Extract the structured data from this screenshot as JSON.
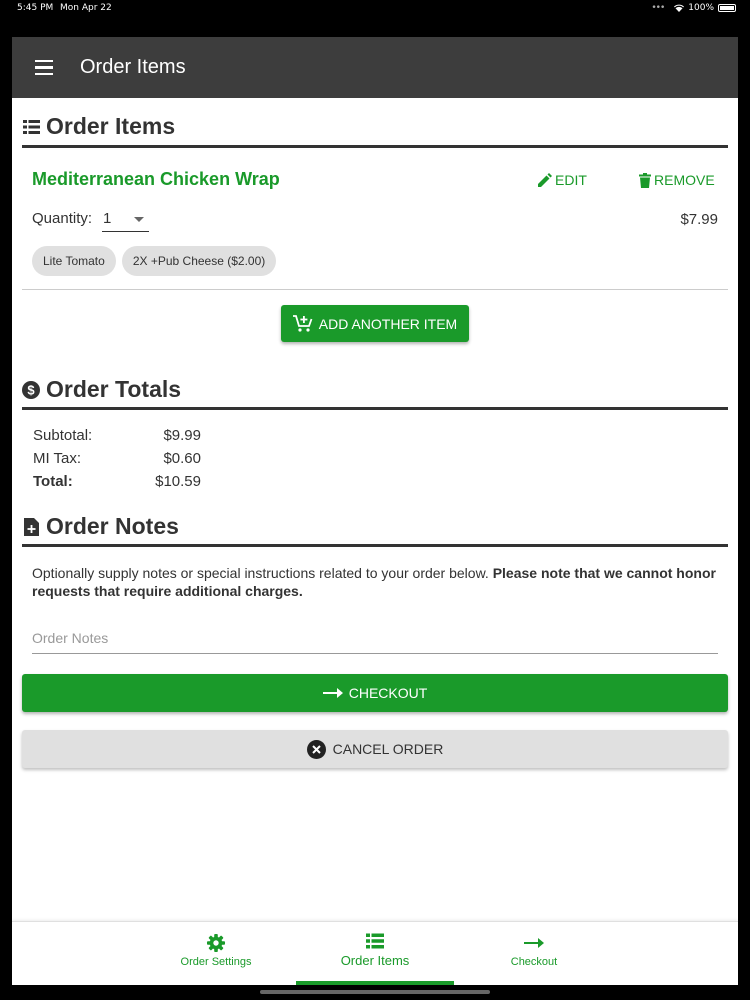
{
  "status_bar": {
    "time": "5:45 PM",
    "date": "Mon Apr 22",
    "battery": "100%"
  },
  "appbar": {
    "title": "Order Items"
  },
  "items_section": {
    "title": "Order Items"
  },
  "item": {
    "name": "Mediterranean Chicken Wrap",
    "edit_label": "EDIT",
    "remove_label": "REMOVE",
    "quantity_label": "Quantity:",
    "quantity_value": "1",
    "price": "$7.99",
    "modifiers": [
      "Lite Tomato",
      "2X +Pub Cheese ($2.00)"
    ]
  },
  "add_button": {
    "label": "ADD ANOTHER ITEM"
  },
  "totals_section": {
    "title": "Order Totals",
    "rows": [
      {
        "label": "Subtotal:",
        "value": "$9.99"
      },
      {
        "label": "MI Tax:",
        "value": "$0.60"
      },
      {
        "label": "Total:",
        "value": "$10.59"
      }
    ]
  },
  "notes_section": {
    "title": "Order Notes",
    "description": "Optionally supply notes or special instructions related to your order below.",
    "description_bold": "Please note that we cannot honor requests that require additional charges.",
    "placeholder": "Order Notes"
  },
  "checkout_button": {
    "label": "CHECKOUT"
  },
  "cancel_button": {
    "label": "CANCEL ORDER"
  },
  "bottom_nav": {
    "items": [
      {
        "label": "Order Settings",
        "icon": "gear-icon"
      },
      {
        "label": "Order Items",
        "icon": "list-icon",
        "active": true
      },
      {
        "label": "Checkout",
        "icon": "arrow-right-icon"
      }
    ]
  },
  "colors": {
    "primary": "#1a9a2a",
    "appbar": "#3d3d3d",
    "chip": "#e0e0e0",
    "text": "#333333"
  }
}
